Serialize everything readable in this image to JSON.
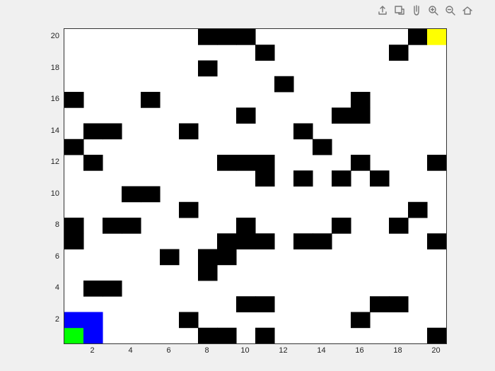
{
  "toolbar": {
    "icons": [
      "share-icon",
      "brush-icon",
      "pan-icon",
      "zoom-in-icon",
      "zoom-out-icon",
      "home-icon"
    ]
  },
  "xticks": [
    "2",
    "4",
    "6",
    "8",
    "10",
    "12",
    "14",
    "16",
    "18",
    "20"
  ],
  "yticks": [
    "2",
    "4",
    "6",
    "8",
    "10",
    "12",
    "14",
    "16",
    "18",
    "20"
  ],
  "chart_data": {
    "type": "heatmap",
    "title": "",
    "xlabel": "",
    "ylabel": "",
    "xlim": [
      0.5,
      20.5
    ],
    "ylim": [
      0.5,
      20.5
    ],
    "nx": 20,
    "ny": 20,
    "colors": {
      "0": "#ffffff",
      "1": "#000000",
      "2": "#0000ff",
      "3": "#00ff00",
      "4": "#ffff00"
    },
    "cells": [
      [
        3,
        2,
        0,
        0,
        0,
        0,
        0,
        1,
        1,
        0,
        1,
        0,
        0,
        0,
        0,
        0,
        0,
        0,
        0,
        1
      ],
      [
        2,
        2,
        0,
        0,
        0,
        0,
        1,
        0,
        0,
        0,
        0,
        0,
        0,
        0,
        0,
        1,
        0,
        0,
        0,
        0
      ],
      [
        0,
        0,
        0,
        0,
        0,
        0,
        0,
        0,
        0,
        1,
        1,
        0,
        0,
        0,
        0,
        0,
        1,
        1,
        0,
        0
      ],
      [
        0,
        1,
        1,
        0,
        0,
        0,
        0,
        0,
        0,
        0,
        0,
        0,
        0,
        0,
        0,
        0,
        0,
        0,
        0,
        0
      ],
      [
        0,
        0,
        0,
        0,
        0,
        0,
        0,
        1,
        0,
        0,
        0,
        0,
        0,
        0,
        0,
        0,
        0,
        0,
        0,
        0
      ],
      [
        0,
        0,
        0,
        0,
        0,
        1,
        0,
        1,
        1,
        0,
        0,
        0,
        0,
        0,
        0,
        0,
        0,
        0,
        0,
        0
      ],
      [
        1,
        0,
        0,
        0,
        0,
        0,
        0,
        0,
        1,
        1,
        1,
        0,
        1,
        1,
        0,
        0,
        0,
        0,
        0,
        1
      ],
      [
        1,
        0,
        1,
        1,
        0,
        0,
        0,
        0,
        0,
        1,
        0,
        0,
        0,
        0,
        1,
        0,
        0,
        1,
        0,
        0
      ],
      [
        0,
        0,
        0,
        0,
        0,
        0,
        1,
        0,
        0,
        0,
        0,
        0,
        0,
        0,
        0,
        0,
        0,
        0,
        1,
        0
      ],
      [
        0,
        0,
        0,
        1,
        1,
        0,
        0,
        0,
        0,
        0,
        0,
        0,
        0,
        0,
        0,
        0,
        0,
        0,
        0,
        0
      ],
      [
        0,
        0,
        0,
        0,
        0,
        0,
        0,
        0,
        0,
        0,
        1,
        0,
        1,
        0,
        1,
        0,
        1,
        0,
        0,
        0
      ],
      [
        0,
        1,
        0,
        0,
        0,
        0,
        0,
        0,
        1,
        1,
        1,
        0,
        0,
        0,
        0,
        1,
        0,
        0,
        0,
        1
      ],
      [
        1,
        0,
        0,
        0,
        0,
        0,
        0,
        0,
        0,
        0,
        0,
        0,
        0,
        1,
        0,
        0,
        0,
        0,
        0,
        0
      ],
      [
        0,
        1,
        1,
        0,
        0,
        0,
        1,
        0,
        0,
        0,
        0,
        0,
        1,
        0,
        0,
        0,
        0,
        0,
        0,
        0
      ],
      [
        0,
        0,
        0,
        0,
        0,
        0,
        0,
        0,
        0,
        1,
        0,
        0,
        0,
        0,
        1,
        1,
        0,
        0,
        0,
        0
      ],
      [
        1,
        0,
        0,
        0,
        1,
        0,
        0,
        0,
        0,
        0,
        0,
        0,
        0,
        0,
        0,
        1,
        0,
        0,
        0,
        0
      ],
      [
        0,
        0,
        0,
        0,
        0,
        0,
        0,
        0,
        0,
        0,
        0,
        1,
        0,
        0,
        0,
        0,
        0,
        0,
        0,
        0
      ],
      [
        0,
        0,
        0,
        0,
        0,
        0,
        0,
        1,
        0,
        0,
        0,
        0,
        0,
        0,
        0,
        0,
        0,
        0,
        0,
        0
      ],
      [
        0,
        0,
        0,
        0,
        0,
        0,
        0,
        0,
        0,
        0,
        1,
        0,
        0,
        0,
        0,
        0,
        0,
        1,
        0,
        0
      ],
      [
        0,
        0,
        0,
        0,
        0,
        0,
        0,
        1,
        1,
        1,
        0,
        0,
        0,
        0,
        0,
        0,
        0,
        0,
        1,
        4
      ]
    ]
  }
}
